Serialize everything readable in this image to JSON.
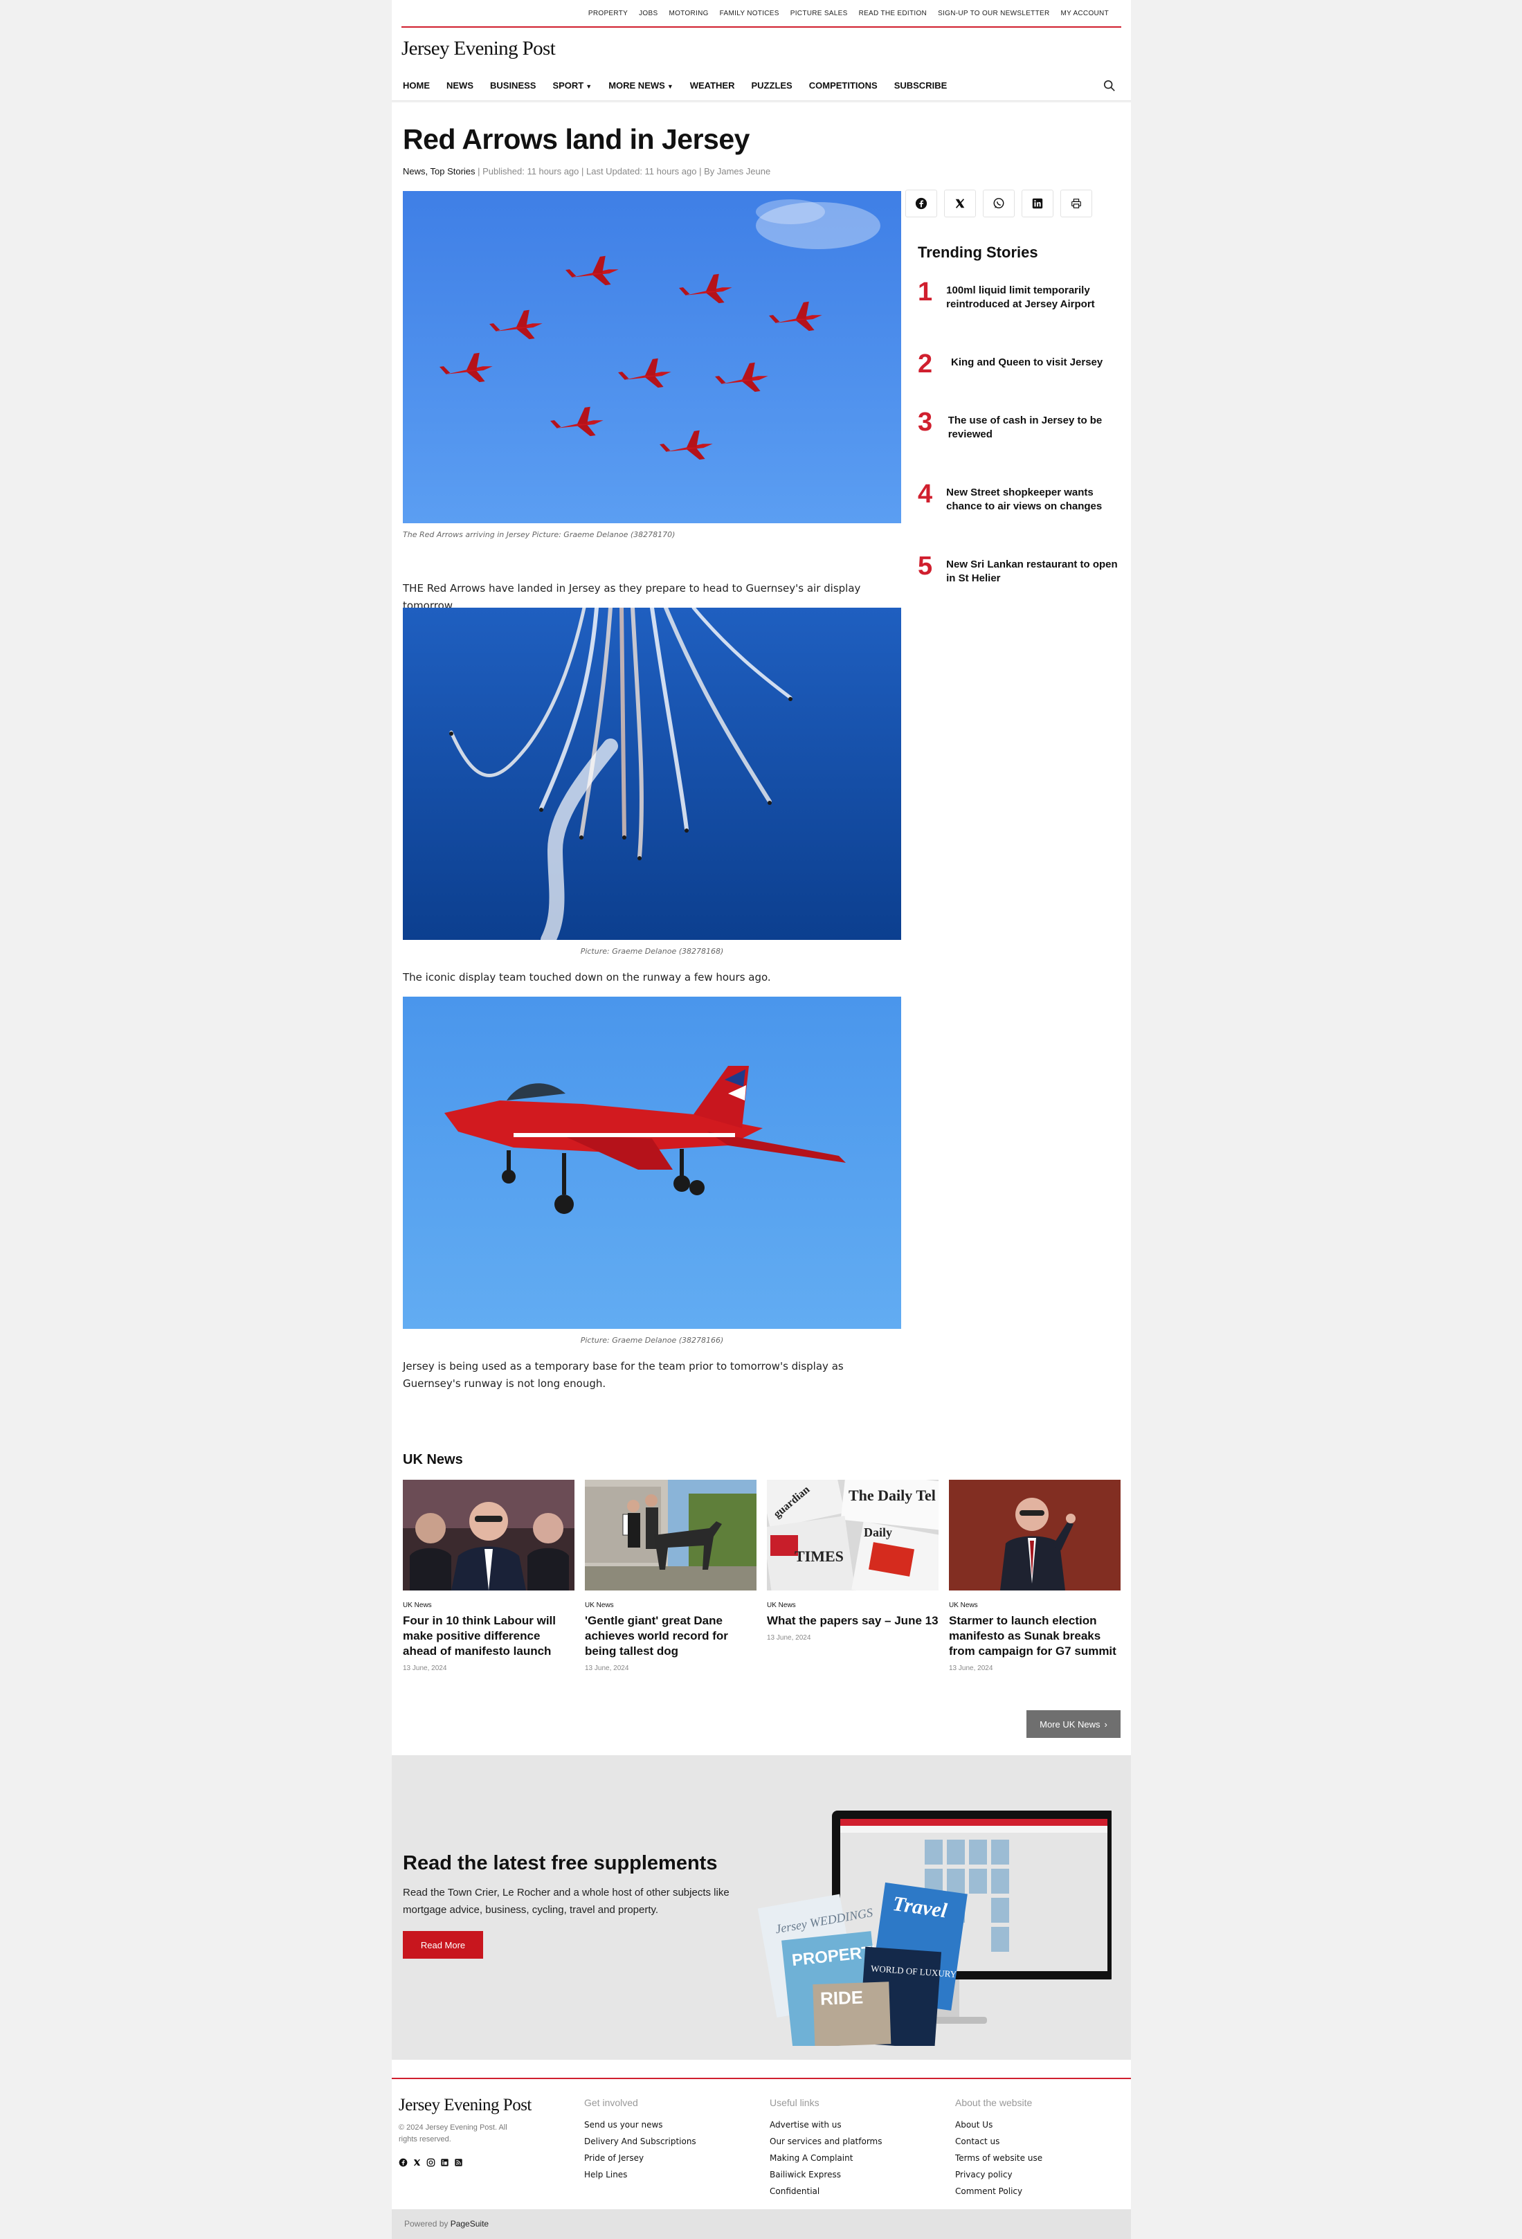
{
  "topbar": {
    "links": [
      "PROPERTY",
      "JOBS",
      "MOTORING",
      "FAMILY NOTICES",
      "PICTURE SALES",
      "READ THE EDITION",
      "SIGN-UP TO OUR NEWSLETTER",
      "MY ACCOUNT"
    ]
  },
  "site": {
    "logo": "Jersey Evening Post"
  },
  "nav": {
    "items": [
      "HOME",
      "NEWS",
      "BUSINESS",
      "SPORT",
      "MORE NEWS",
      "WEATHER",
      "PUZZLES",
      "COMPETITIONS",
      "SUBSCRIBE"
    ]
  },
  "article": {
    "title": "Red Arrows land in Jersey",
    "categories": "News, Top Stories",
    "meta_rest": " | Published: 11 hours ago | Last Updated: 11 hours ago | By James Jeune",
    "caption1": "The Red Arrows arriving in Jersey Picture: Graeme Delanoe (38278170)",
    "para1": "THE Red Arrows have landed in Jersey as they prepare to head to Guernsey's air display tomorrow.",
    "caption2": "Picture: Graeme Delanoe (38278168)",
    "para2": "The iconic display team touched down on the runway a few hours ago.",
    "caption3": "Picture: Graeme Delanoe (38278166)",
    "para3": "Jersey is being used as a temporary base for the team prior to tomorrow's display as Guernsey's runway is not long enough."
  },
  "share": {
    "icons": [
      "facebook-icon",
      "x-icon",
      "whatsapp-icon",
      "linkedin-icon",
      "print-icon"
    ]
  },
  "trending": {
    "title": "Trending Stories",
    "items": [
      {
        "num": "1",
        "text": "100ml liquid limit temporarily reintroduced at Jersey Airport"
      },
      {
        "num": "2",
        "text": "King and Queen to visit Jersey"
      },
      {
        "num": "3",
        "text": "The use of cash in Jersey to be reviewed"
      },
      {
        "num": "4",
        "text": "New Street shopkeeper wants chance to air views on changes"
      },
      {
        "num": "5",
        "text": "New Sri Lankan restaurant to open in St Helier"
      }
    ]
  },
  "uk_news": {
    "title": "UK News",
    "more_label": "More UK News",
    "cards": [
      {
        "category": "UK News",
        "headline": "Four in 10 think Labour will make positive difference ahead of manifesto launch",
        "date": "13 June, 2024"
      },
      {
        "category": "UK News",
        "headline": "'Gentle giant' great Dane achieves world record for being tallest dog",
        "date": "13 June, 2024"
      },
      {
        "category": "UK News",
        "headline": "What the papers say – June 13",
        "date": "13 June, 2024"
      },
      {
        "category": "UK News",
        "headline": "Starmer to launch election manifesto as Sunak breaks from campaign for G7 summit",
        "date": "13 June, 2024"
      }
    ]
  },
  "supplements": {
    "title": "Read the latest free supplements",
    "text": "Read the Town Crier, Le Rocher and a whole host of other subjects like mortgage advice, business, cycling, travel and property.",
    "button": "Read More",
    "mag_labels": [
      "Jersey WEDDINGS",
      "PROPERTY",
      "Travel",
      "WORLD OF LUXURY",
      "RIDE"
    ]
  },
  "footer": {
    "logo": "Jersey Evening Post",
    "copyright": "© 2024 Jersey Evening Post. All rights reserved.",
    "columns": [
      {
        "heading": "Get involved",
        "links": [
          "Send us your news",
          "Delivery And Subscriptions",
          "Pride of Jersey",
          "Help Lines"
        ]
      },
      {
        "heading": "Useful links",
        "links": [
          "Advertise with us",
          "Our services and platforms",
          "Making A Complaint",
          "Bailiwick Express",
          "Confidential"
        ]
      },
      {
        "heading": "About the website",
        "links": [
          "About Us",
          "Contact us",
          "Terms of website use",
          "Privacy policy",
          "Comment Policy"
        ]
      }
    ],
    "powered_prefix": "Powered by ",
    "powered_brand": "PageSuite"
  },
  "colors": {
    "accent_red": "#d01f2e",
    "button_red": "#c8161e",
    "sky_blue": "#4a8eea",
    "grey_button": "#6f6f6f"
  }
}
